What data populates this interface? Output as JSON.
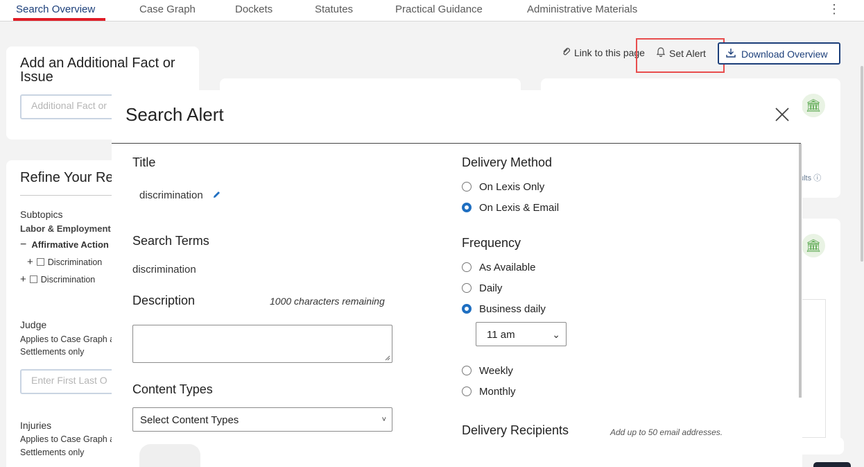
{
  "tabs": [
    {
      "label": "Search Overview",
      "active": true
    },
    {
      "label": "Case Graph"
    },
    {
      "label": "Dockets"
    },
    {
      "label": "Statutes"
    },
    {
      "label": "Practical Guidance"
    },
    {
      "label": "Administrative Materials"
    }
  ],
  "more_icon": "⋮",
  "add_fact": {
    "title": "Add an Additional Fact or Issue",
    "placeholder": "Additional Fact or"
  },
  "refine": {
    "title": "Refine Your Re",
    "subtopics_label": "Subtopics",
    "subtopic_path": "Labor & Employment",
    "item_affirmative": "Affirmative Action",
    "item_discrimination_child": "Discrimination",
    "item_discrimination": "Discrimination",
    "judge_label": "Judge",
    "judge_note_1": "Applies to Case Graph a",
    "judge_note_2": "Settlements only",
    "judge_placeholder": "Enter First Last O",
    "injuries_label": "Injuries",
    "injuries_note_1": "Applies to Case Graph a",
    "injuries_note_2": "Settlements only"
  },
  "toolbar": {
    "link_label": "Link to this page",
    "alert_label": "Set Alert",
    "download_label": "Download Overview"
  },
  "background_snippet": "ults",
  "modal": {
    "title": "Search Alert",
    "title_label": "Title",
    "title_value": "discrimination",
    "search_terms_label": "Search Terms",
    "search_terms_value": "discrimination",
    "description_label": "Description",
    "chars_remaining": "1000 characters remaining",
    "content_types_label": "Content Types",
    "content_types_select": "Select Content Types",
    "delivery_method_label": "Delivery Method",
    "delivery_options": [
      "On Lexis Only",
      "On Lexis & Email"
    ],
    "delivery_selected": "On Lexis & Email",
    "frequency_label": "Frequency",
    "frequency_options": [
      "As Available",
      "Daily",
      "Business daily",
      "Weekly",
      "Monthly"
    ],
    "frequency_selected": "Business daily",
    "time_select": "11 am",
    "recipients_label": "Delivery Recipients",
    "recipients_note": "Add up to 50 email addresses."
  },
  "colors": {
    "accent_red": "#e01d27",
    "navy": "#1c3f7a",
    "radio_blue": "#1f6fc1",
    "highlight": "#e84e4e"
  }
}
